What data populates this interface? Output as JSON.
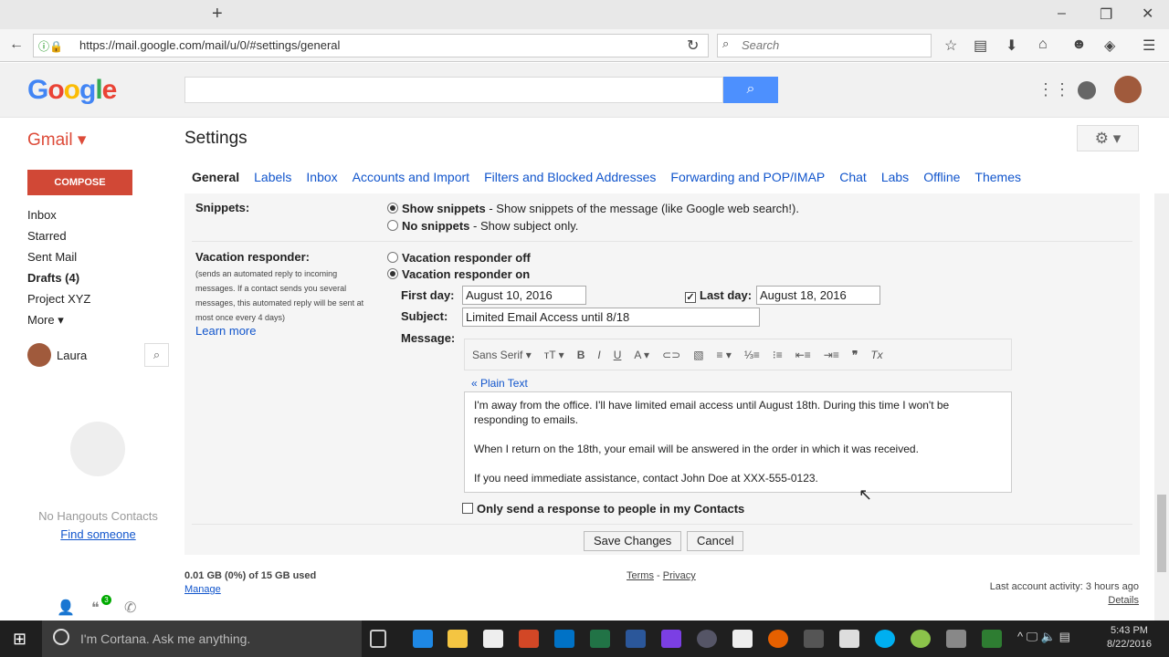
{
  "browser": {
    "url": "https://mail.google.com/mail/u/0/#settings/general",
    "search_placeholder": "Search",
    "new_tab": "+"
  },
  "google": {
    "logo": "Google"
  },
  "gmail": {
    "label": "Gmail ▾",
    "compose": "COMPOSE",
    "nav": [
      "Inbox",
      "Starred",
      "Sent Mail",
      "Drafts (4)",
      "Project XYZ",
      "More ▾"
    ],
    "user": "Laura",
    "hangouts_empty": "No Hangouts Contacts",
    "find_someone": "Find someone",
    "hangouts_badge": "3"
  },
  "settings": {
    "title": "Settings",
    "tabs": [
      "General",
      "Labels",
      "Inbox",
      "Accounts and Import",
      "Filters and Blocked Addresses",
      "Forwarding and POP/IMAP",
      "Chat",
      "Labs",
      "Offline",
      "Themes"
    ],
    "snippets": {
      "label": "Snippets:",
      "opt1_bold": "Show snippets",
      "opt1_rest": " - Show snippets of the message (like Google web search!).",
      "opt2_bold": "No snippets",
      "opt2_rest": " - Show subject only.",
      "selected": "Show snippets"
    },
    "vacation": {
      "label": "Vacation responder:",
      "desc": "(sends an automated reply to incoming messages. If a contact sends you several messages, this automated reply will be sent at most once every 4 days)",
      "learn_more": "Learn more",
      "off": "Vacation responder off",
      "on": "Vacation responder on",
      "selected": "on",
      "first_day_label": "First day:",
      "first_day": "August 10, 2016",
      "last_day_label": "Last day:",
      "last_day_checked": true,
      "last_day": "August 18, 2016",
      "subject_label": "Subject:",
      "subject": "Limited Email Access until 8/18",
      "message_label": "Message:",
      "font": "Sans Serif ▾",
      "plain_text": "« Plain Text",
      "message": [
        "I'm away from the office. I'll have limited email access until August 18th. During this time I won't be responding to emails.",
        "When I return on the 18th, your email will be answered in the order in which it was received.",
        "If you need immediate assistance, contact John Doe at XXX-555-0123."
      ],
      "contacts_only": "Only send a response to people in my Contacts",
      "contacts_only_checked": false
    },
    "save": "Save Changes",
    "cancel": "Cancel"
  },
  "footer": {
    "storage": "0.01 GB (0%) of 15 GB used",
    "manage": "Manage",
    "terms": "Terms",
    "sep": " - ",
    "privacy": "Privacy",
    "activity": "Last account activity: 3 hours ago",
    "details": "Details"
  },
  "taskbar": {
    "cortana": "I'm Cortana. Ask me anything.",
    "time": "5:43 PM",
    "date": "8/22/2016"
  },
  "colors": {
    "accent": "#4d90fe",
    "compose": "#d14836",
    "link": "#1155cc"
  }
}
